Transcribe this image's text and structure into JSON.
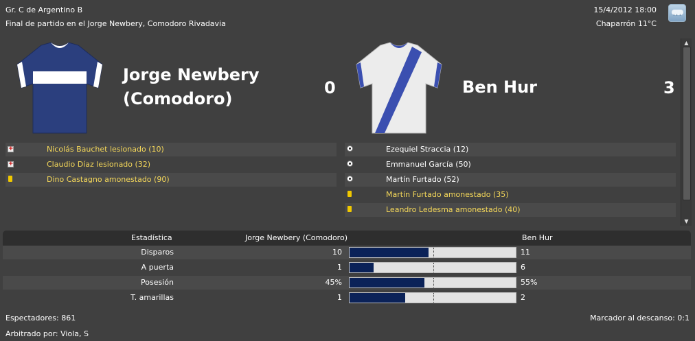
{
  "header": {
    "competition": "Gr. C de Argentino B",
    "subtitle": "Final de partido en el Jorge Newbery, Comodoro Rivadavia",
    "datetime": "15/4/2012 18:00",
    "weather": "Chaparrón 11°C",
    "weather_icon": "rain-cloud-icon"
  },
  "home": {
    "name_line1": "Jorge Newbery",
    "name_line2": "(Comodoro)",
    "score": "0",
    "shirt": {
      "primary": "#2b3f7e",
      "band": "#ffffff"
    },
    "events": [
      {
        "icon": "injury-icon",
        "text": "Nicolás Bauchet lesionado (10)",
        "color": "yellow"
      },
      {
        "icon": "injury-icon",
        "text": "Claudio Díaz lesionado (32)",
        "color": "yellow"
      },
      {
        "icon": "yellow-card-icon",
        "text": "Dino Castagno amonestado (90)",
        "color": "yellow"
      }
    ]
  },
  "away": {
    "name": "Ben Hur",
    "score": "3",
    "shirt": {
      "primary": "#ececec",
      "band": "#3b4fb0"
    },
    "events": [
      {
        "icon": "ball-icon",
        "text": "Ezequiel Straccia (12)",
        "color": "white"
      },
      {
        "icon": "ball-icon",
        "text": "Emmanuel García (50)",
        "color": "white"
      },
      {
        "icon": "ball-icon",
        "text": "Martín Furtado (52)",
        "color": "white"
      },
      {
        "icon": "yellow-card-icon",
        "text": "Martín Furtado amonestado (35)",
        "color": "yellow"
      },
      {
        "icon": "yellow-card-icon",
        "text": "Leandro Ledesma amonestado (40)",
        "color": "yellow"
      }
    ]
  },
  "stats": {
    "header_label": "Estadística",
    "home_label": "Jorge Newbery (Comodoro)",
    "away_label": "Ben Hur",
    "rows": [
      {
        "label": "Disparos",
        "home": "10",
        "away": "11",
        "home_fraction": 0.476
      },
      {
        "label": "A puerta",
        "home": "1",
        "away": "6",
        "home_fraction": 0.143
      },
      {
        "label": "Posesión",
        "home": "45%",
        "away": "55%",
        "home_fraction": 0.45
      },
      {
        "label": "T. amarillas",
        "home": "1",
        "away": "2",
        "home_fraction": 0.333
      }
    ]
  },
  "footer": {
    "spectators": "Espectadores: 861",
    "referee": "Arbitrado por: Viola, S",
    "halftime": "Marcador al descanso: 0:1"
  },
  "colors": {
    "bar_fill": "#0b2258",
    "event_yellow": "#f5d85a"
  }
}
